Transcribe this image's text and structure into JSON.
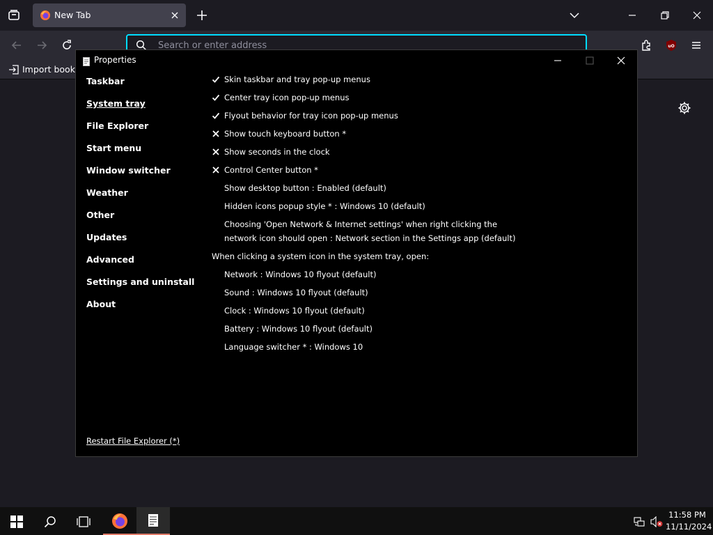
{
  "browser": {
    "tab_title": "New Tab",
    "url_placeholder": "Search or enter address",
    "bookmark_label": "Import bookm"
  },
  "dialog": {
    "title": "Properties",
    "sidebar": [
      {
        "label": "Taskbar",
        "active": false
      },
      {
        "label": "System tray",
        "active": true
      },
      {
        "label": "File Explorer",
        "active": false
      },
      {
        "label": "Start menu",
        "active": false
      },
      {
        "label": "Window switcher",
        "active": false
      },
      {
        "label": "Weather",
        "active": false
      },
      {
        "label": "Other",
        "active": false
      },
      {
        "label": "Updates",
        "active": false
      },
      {
        "label": "Advanced",
        "active": false
      },
      {
        "label": "Settings and uninstall",
        "active": false
      },
      {
        "label": "About",
        "active": false
      }
    ],
    "restart_link": "Restart File Explorer (*)",
    "settings": [
      {
        "mark": "check",
        "text": "Skin taskbar and tray pop-up menus"
      },
      {
        "mark": "check",
        "text": "Center tray icon pop-up menus"
      },
      {
        "mark": "check",
        "text": "Flyout behavior for tray icon pop-up menus"
      },
      {
        "mark": "cross",
        "text": "Show touch keyboard button *"
      },
      {
        "mark": "cross",
        "text": "Show seconds in the clock"
      },
      {
        "mark": "cross",
        "text": "Control Center button *"
      },
      {
        "mark": "none",
        "text": "Show desktop button : Enabled (default)"
      },
      {
        "mark": "none",
        "text": "Hidden icons popup style * : Windows 10 (default)"
      },
      {
        "mark": "none",
        "text": "Choosing 'Open Network & Internet settings' when right clicking the",
        "text2": "network icon should open : Network section in the Settings app (default)"
      },
      {
        "mark": "header",
        "text": "When clicking a system icon in the system tray, open:"
      },
      {
        "mark": "none",
        "text": "Network : Windows 10 flyout (default)"
      },
      {
        "mark": "none",
        "text": "Sound : Windows 10 flyout (default)"
      },
      {
        "mark": "none",
        "text": "Clock : Windows 10 flyout (default)"
      },
      {
        "mark": "none",
        "text": "Battery : Windows 10 flyout (default)"
      },
      {
        "mark": "none",
        "text": "Language switcher * : Windows 10"
      }
    ]
  },
  "taskbar": {
    "time": "11:58 PM",
    "date": "11/11/2024"
  },
  "colors": {
    "url_focus": "#00ddff",
    "dialog_bg": "#000000",
    "taskbar_bg": "#101010",
    "active_indicator": "#e07a68"
  }
}
